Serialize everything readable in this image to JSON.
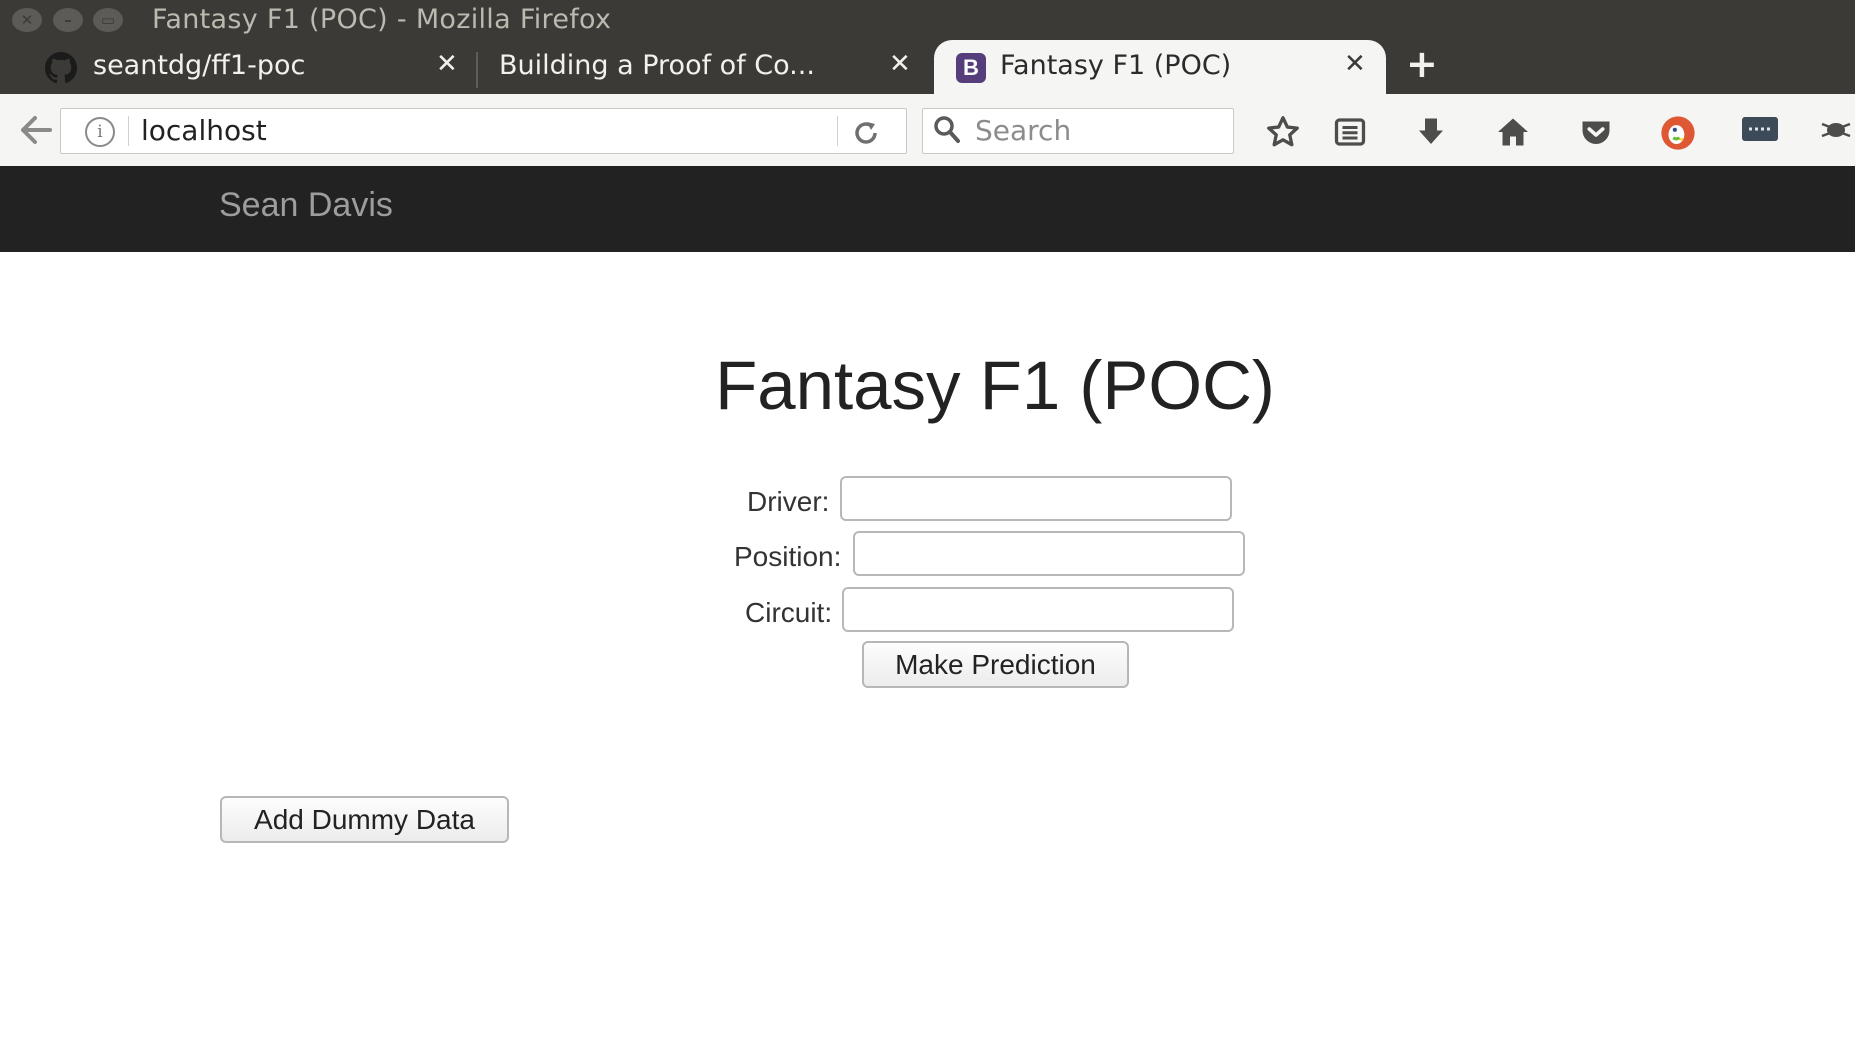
{
  "window": {
    "title": "Fantasy F1 (POC) - Mozilla Firefox"
  },
  "tabs": [
    {
      "label": "seantdg/ff1-poc",
      "icon": "github-icon",
      "active": false
    },
    {
      "label": "Building a Proof of Co...",
      "icon": "",
      "active": false
    },
    {
      "label": "Fantasy F1 (POC)",
      "icon": "bootstrap-icon",
      "icon_letter": "B",
      "active": true
    }
  ],
  "toolbar": {
    "url": "localhost",
    "search_placeholder": "Search"
  },
  "page": {
    "brand": "Sean Davis",
    "title": "Fantasy F1 (POC)",
    "form": {
      "driver_label": "Driver:",
      "driver_value": "",
      "position_label": "Position:",
      "position_value": "",
      "circuit_label": "Circuit:",
      "circuit_value": "",
      "submit_label": "Make Prediction"
    },
    "dummy_button_label": "Add Dummy Data"
  },
  "colors": {
    "titlebar": "#3b3a36",
    "site_navbar": "#222222",
    "brand_text": "#9d9d9d",
    "bootstrap_purple": "#563d7c",
    "duckduckgo_orange": "#de5833"
  }
}
